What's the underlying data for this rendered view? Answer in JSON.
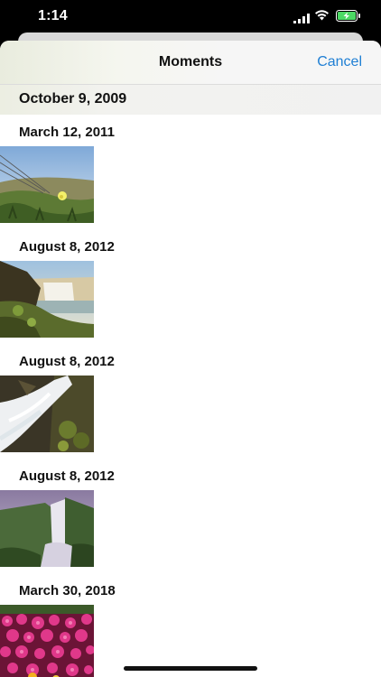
{
  "status": {
    "time": "1:14"
  },
  "nav": {
    "title": "Moments",
    "cancel_label": "Cancel"
  },
  "pinned_section": {
    "label": "October 9, 2009"
  },
  "moments": [
    {
      "date": "March 12, 2011"
    },
    {
      "date": "August 8, 2012"
    },
    {
      "date": "August 8, 2012"
    },
    {
      "date": "August 8, 2012"
    },
    {
      "date": "March 30, 2018"
    }
  ],
  "colors": {
    "accent": "#1f7fd4",
    "battery": "#4cd964"
  }
}
